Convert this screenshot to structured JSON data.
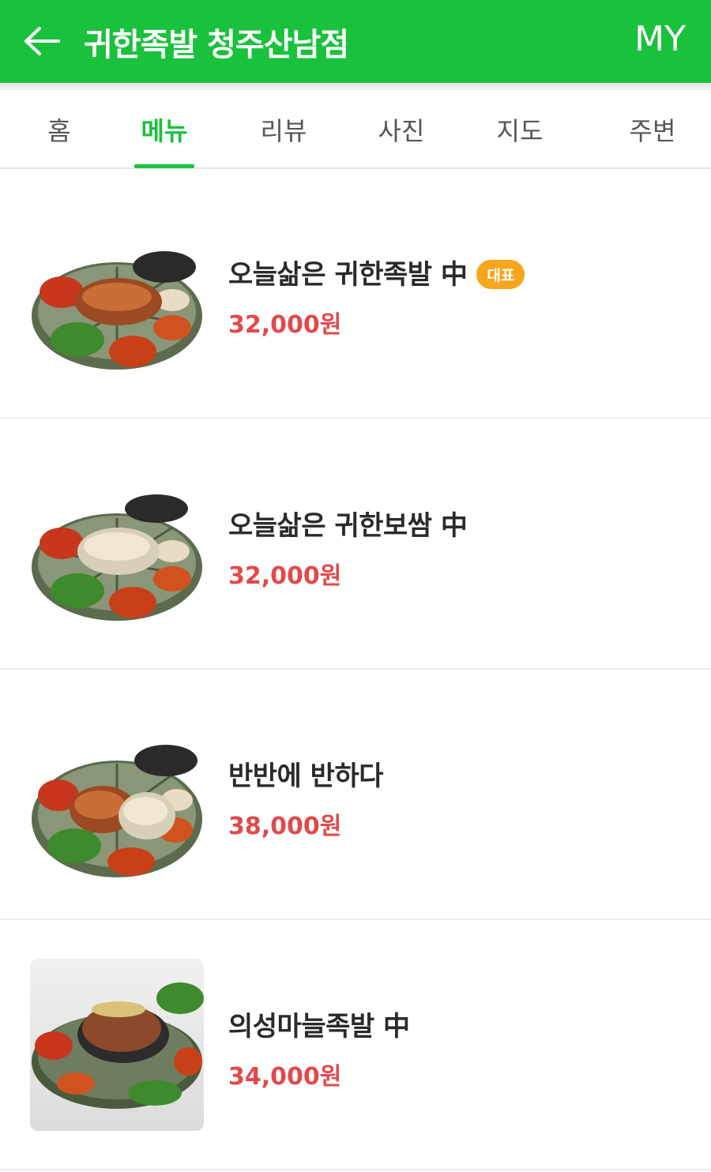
{
  "header": {
    "title": "귀한족발 청주산남점",
    "my_label": "MY",
    "back_icon": "arrow-left-icon",
    "color": "#19c13d"
  },
  "tabs": [
    {
      "label": "홈",
      "active": false
    },
    {
      "label": "메뉴",
      "active": true
    },
    {
      "label": "리뷰",
      "active": false
    },
    {
      "label": "사진",
      "active": false
    },
    {
      "label": "지도",
      "active": false
    },
    {
      "label": "주변",
      "active": false
    }
  ],
  "menu": [
    {
      "name": "오늘삶은 귀한족발 中",
      "badge": "대표",
      "price": "32,000원"
    },
    {
      "name": "오늘삶은 귀한보쌈 中",
      "price": "32,000원"
    },
    {
      "name": "반반에 반하다",
      "price": "38,000원"
    },
    {
      "name": "의성마늘족발 中",
      "price": "34,000원"
    }
  ],
  "colors": {
    "accent": "#19c13d",
    "price": "#e2494b",
    "badge": "#f7a51d"
  }
}
